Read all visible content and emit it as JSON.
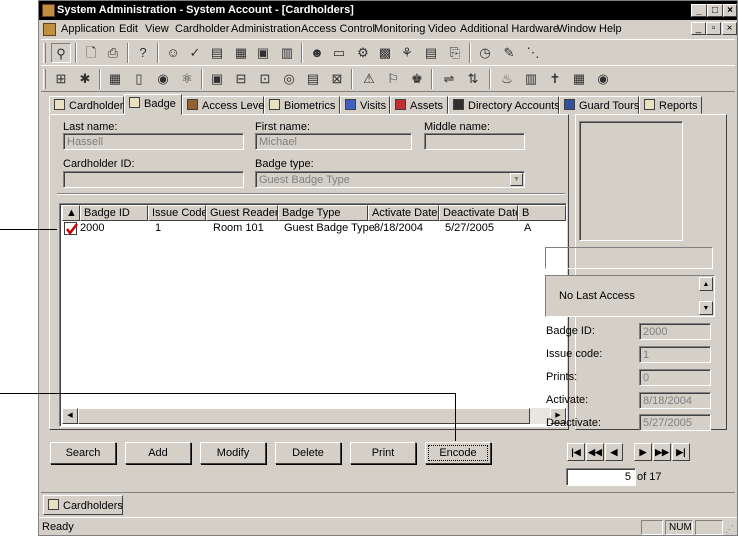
{
  "window": {
    "title": "System Administration - System Account - [Cardholders]"
  },
  "menu": [
    "Application",
    "Edit",
    "View",
    "Cardholder",
    "Administration",
    "Access Control",
    "Monitoring",
    "Video",
    "Additional Hardware",
    "Window",
    "Help"
  ],
  "tabs": [
    {
      "label": "Cardholder",
      "icon": "cardholder-icon"
    },
    {
      "label": "Badge",
      "icon": "badge-icon"
    },
    {
      "label": "Access Levels",
      "icon": "access-levels-icon"
    },
    {
      "label": "Biometrics",
      "icon": "fingerprint-icon"
    },
    {
      "label": "Visits",
      "icon": "visits-icon"
    },
    {
      "label": "Assets",
      "icon": "assets-icon"
    },
    {
      "label": "Directory Accounts",
      "icon": "directory-icon"
    },
    {
      "label": "Guard Tours",
      "icon": "guard-tours-icon"
    },
    {
      "label": "Reports",
      "icon": "reports-icon"
    }
  ],
  "form": {
    "last_name_label": "Last name:",
    "last_name": "Hassell",
    "first_name_label": "First name:",
    "first_name": "Michael",
    "middle_name_label": "Middle name:",
    "middle_name": "",
    "cardholder_id_label": "Cardholder ID:",
    "cardholder_id": "",
    "badge_type_label": "Badge type:",
    "badge_type": "Guest Badge Type"
  },
  "badge_table": {
    "columns": [
      "Badge ID",
      "Issue Code",
      "Guest Reader",
      "Badge Type",
      "Activate Date",
      "Deactivate Date",
      "B"
    ],
    "rows": [
      {
        "badge_id": "2000",
        "issue_code": "1",
        "guest_reader": "Room 101",
        "badge_type": "Guest Badge Type",
        "activate": "8/18/2004",
        "deactivate": "5/27/2005",
        "extra": "A"
      }
    ]
  },
  "right_panel": {
    "last_access": "No Last Access",
    "badge_id_label": "Badge ID:",
    "badge_id": "2000",
    "issue_code_label": "Issue code:",
    "issue_code": "1",
    "prints_label": "Prints:",
    "prints": "0",
    "activate_label": "Activate:",
    "activate": "8/18/2004",
    "deactivate_label": "Deactivate:",
    "deactivate": "5/27/2005"
  },
  "buttons": {
    "search": "Search",
    "add": "Add",
    "modify": "Modify",
    "delete": "Delete",
    "print": "Print",
    "encode": "Encode"
  },
  "record_nav": {
    "current": "5",
    "total_label": "of 17"
  },
  "bottom_tab": "Cardholders",
  "status": {
    "text": "Ready",
    "num": "NUM"
  },
  "colors": {
    "titlebar": "#000000",
    "face": "#d4d0c8",
    "checkmark": "#cc0000"
  }
}
